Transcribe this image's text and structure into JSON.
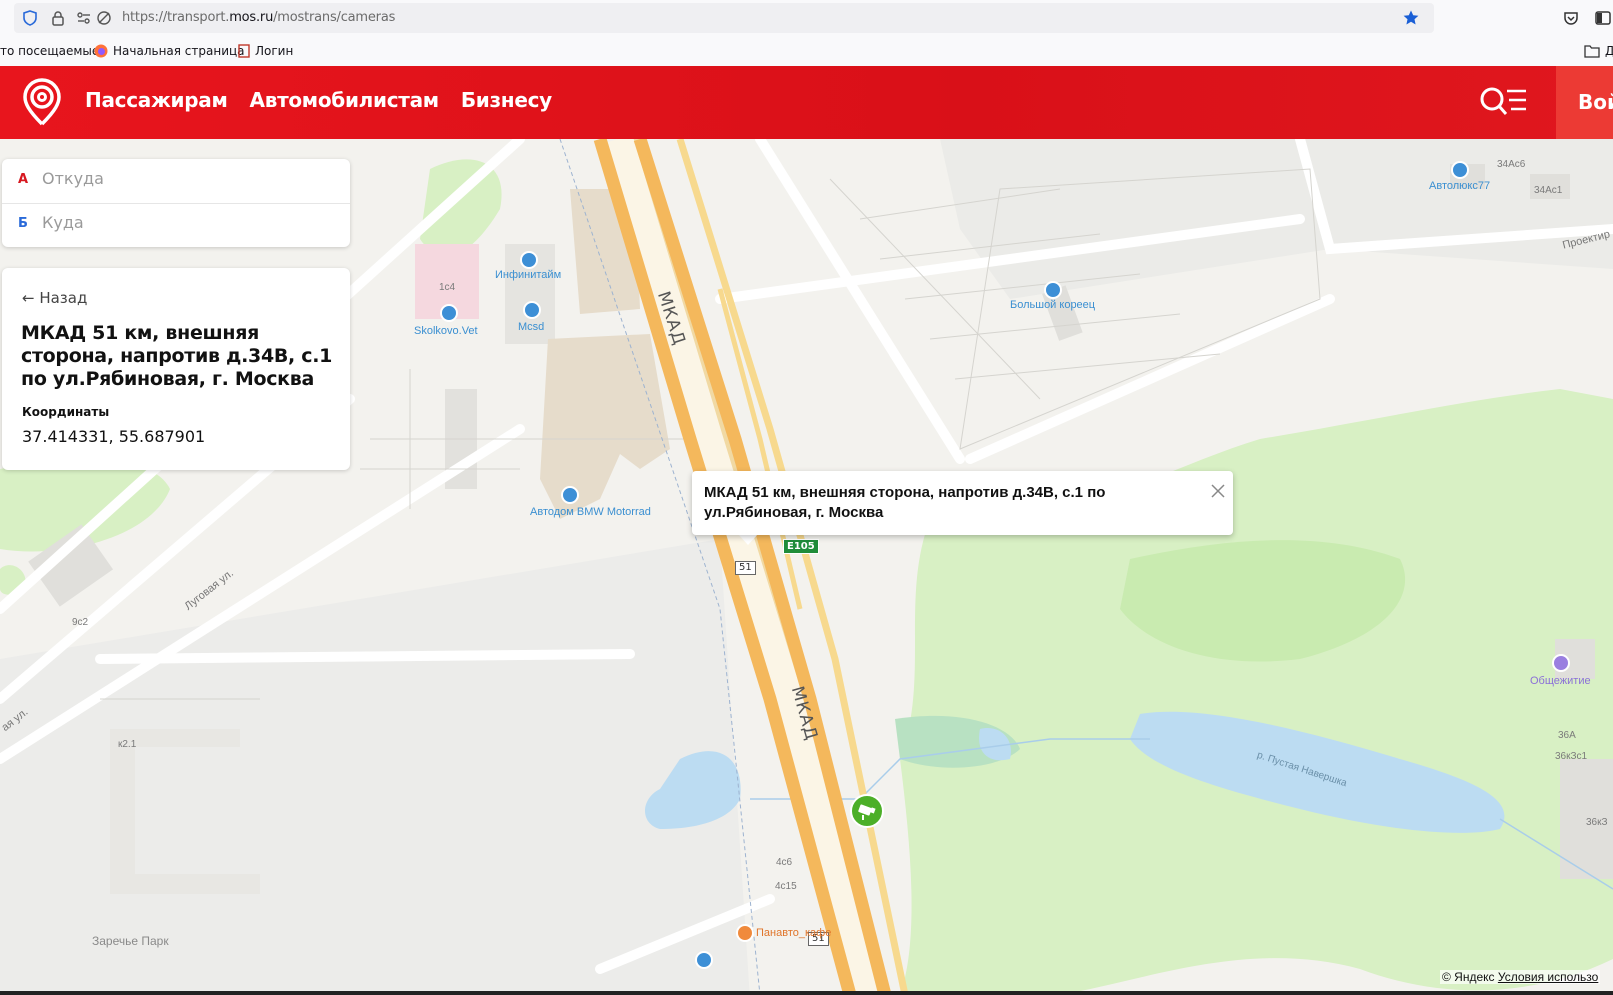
{
  "browser": {
    "url_prefix": "https://transport.",
    "url_domain": "mos.ru",
    "url_path": "/mostrans/cameras"
  },
  "bookmarks": {
    "items": [
      "то посещаемые",
      "Начальная страница",
      "Логин"
    ],
    "other": "Др"
  },
  "header": {
    "nav": [
      "Пассажирам",
      "Автомобилистам",
      "Бизнесу"
    ],
    "login": "Войти",
    "brand_color": "#e8151d"
  },
  "route": {
    "from_letter": "А",
    "from_placeholder": "Откуда",
    "to_letter": "Б",
    "to_placeholder": "Куда"
  },
  "info": {
    "back": "← Назад",
    "title": "МКАД 51 км, внешняя сторона, напротив д.34В, с.1 по ул.Рябиновая, г. Москва",
    "coords_label": "Координаты",
    "coords_value": "37.414331, 55.687901"
  },
  "balloon": {
    "text": "МКАД 51 км, внешняя сторона, напротив д.34В, с.1 по ул.Рябиновая, г. Москва"
  },
  "map": {
    "road_name": "МКАД",
    "route_number": "51",
    "euro_route": "E105",
    "street_lugovaya": "Луговая ул.",
    "street_partial": "ая ул.",
    "street_proekt": "Проектир",
    "river": "р. Пустая Навершка",
    "area_zarechye": "Заречье Парк",
    "pois": {
      "skolkovo_vet": "Skolkovo.Vet",
      "infinitime": "Инфинитайм",
      "mcsd": "Mcsd",
      "avtodom": "Автодом BMW Motorrad",
      "bolshoi_koreets": "Большой кореец",
      "avtolux": "Автолюкс77",
      "obshchezhitie": "Общежитие",
      "panavto": "Панавто_кафе"
    },
    "buildings": {
      "b1c4": "1с4",
      "b9c2": "9с2",
      "bk21": "к2.1",
      "b4c6": "4с6",
      "b4c15": "4с15",
      "b34ac6": "34Ас6",
      "b34ac1": "34Ас1",
      "b36a": "36А",
      "b36c1": "36кЗс1",
      "b36k3": "36кЗ"
    },
    "colors": {
      "highway": "#f6c46a",
      "park": "#d7f0c2",
      "water": "#bfdcf2",
      "camera": "#4caf28"
    }
  },
  "footer": {
    "copyright": "© Яндекс",
    "terms": "Условия использо"
  }
}
